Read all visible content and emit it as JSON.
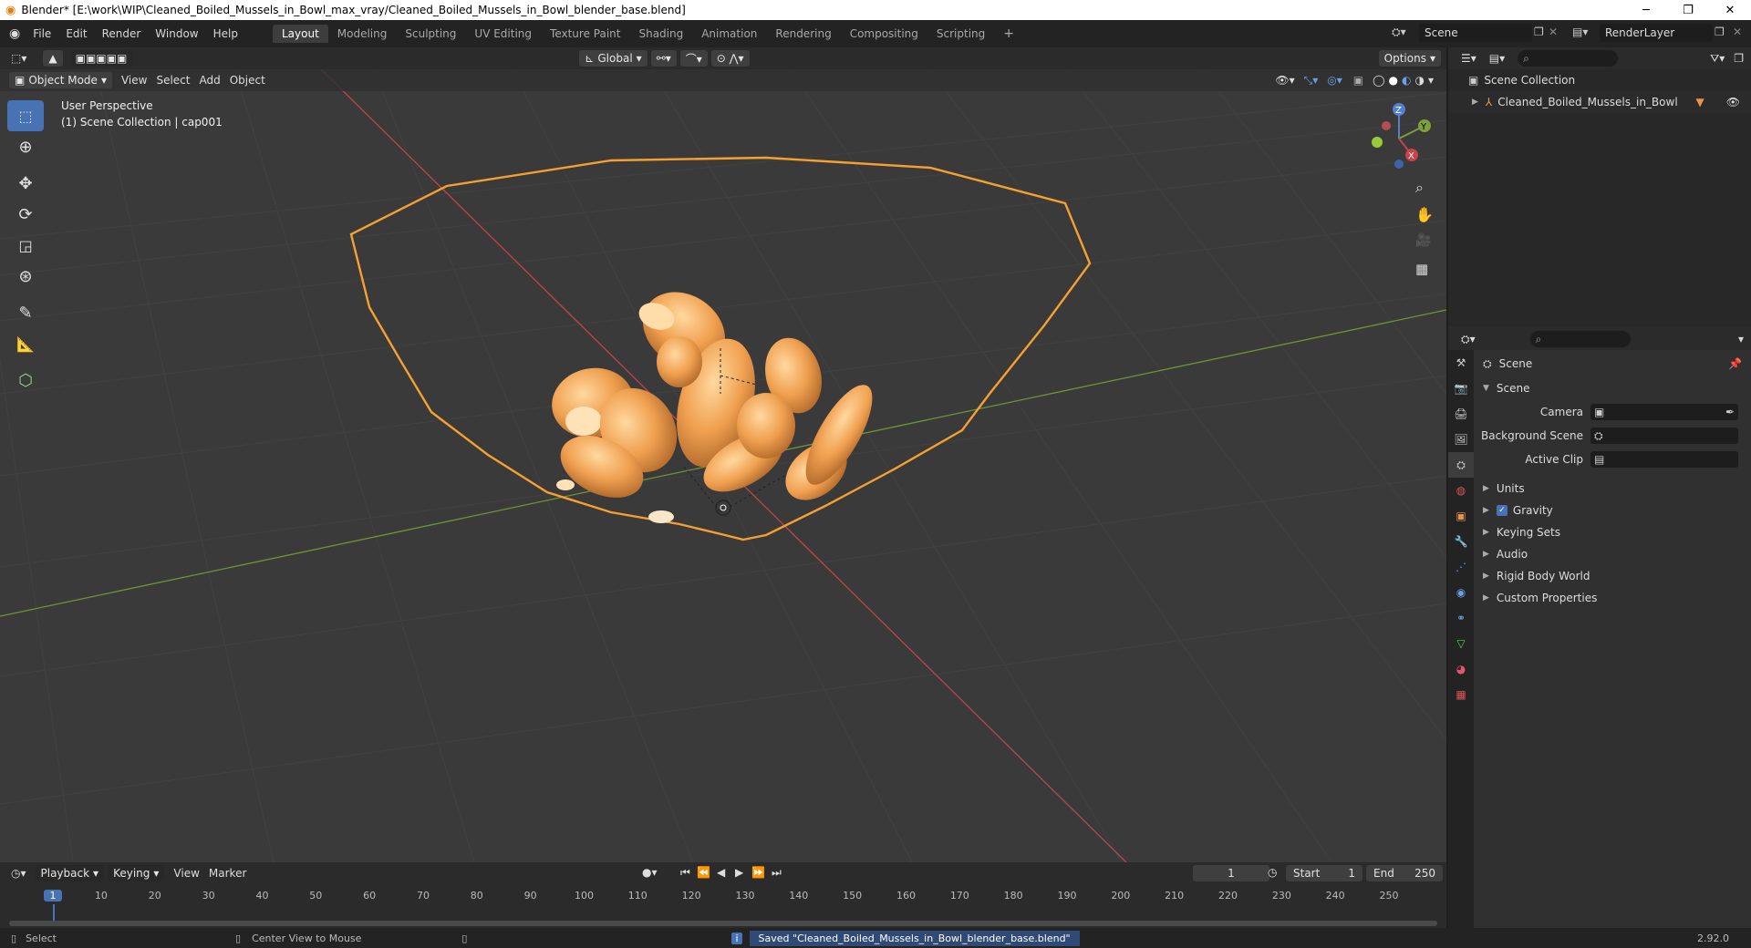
{
  "window": {
    "title": "Blender* [E:\\work\\WIP\\Cleaned_Boiled_Mussels_in_Bowl_max_vray/Cleaned_Boiled_Mussels_in_Bowl_blender_base.blend]",
    "minimize": "─",
    "restore": "❐",
    "close": "✕"
  },
  "menubar": {
    "items": [
      "File",
      "Edit",
      "Render",
      "Window",
      "Help"
    ],
    "workspaces": [
      "Layout",
      "Modeling",
      "Sculpting",
      "UV Editing",
      "Texture Paint",
      "Shading",
      "Animation",
      "Rendering",
      "Compositing",
      "Scripting"
    ],
    "active_workspace": "Layout",
    "add_workspace": "+",
    "scene_name": "Scene",
    "view_layer": "RenderLayer"
  },
  "viewport": {
    "mode": "Object Mode",
    "menus": [
      "View",
      "Select",
      "Add",
      "Object"
    ],
    "transform_orientation": "Global",
    "options_label": "Options",
    "perspective_label": "User Perspective",
    "collection_label": "(1) Scene Collection | cap001",
    "axis_labels": {
      "z": "Z",
      "y": "Y",
      "x": "X"
    }
  },
  "timeline": {
    "menus": [
      "Playback",
      "Keying",
      "View",
      "Marker"
    ],
    "current_frame": "1",
    "start_label": "Start",
    "start_value": "1",
    "end_label": "End",
    "end_value": "250",
    "ruler_ticks": [
      "1",
      "10",
      "20",
      "30",
      "40",
      "50",
      "60",
      "70",
      "80",
      "90",
      "100",
      "110",
      "120",
      "130",
      "140",
      "150",
      "160",
      "170",
      "180",
      "190",
      "200",
      "210",
      "220",
      "230",
      "240",
      "250"
    ]
  },
  "statusbar": {
    "select": "Select",
    "center_view": "Center View to Mouse",
    "message": "Saved \"Cleaned_Boiled_Mussels_in_Bowl_blender_base.blend\"",
    "version": "2.92.0"
  },
  "outliner": {
    "root": "Scene Collection",
    "items": [
      {
        "label": "Cleaned_Boiled_Mussels_in_Bowl"
      }
    ]
  },
  "properties": {
    "context_title": "Scene",
    "section_title": "Scene",
    "fields": [
      {
        "label": "Camera"
      },
      {
        "label": "Background Scene"
      },
      {
        "label": "Active Clip"
      }
    ],
    "panels": [
      {
        "label": "Units",
        "checkbox": false
      },
      {
        "label": "Gravity",
        "checkbox": true
      },
      {
        "label": "Keying Sets",
        "checkbox": false
      },
      {
        "label": "Audio",
        "checkbox": false
      },
      {
        "label": "Rigid Body World",
        "checkbox": false
      },
      {
        "label": "Custom Properties",
        "checkbox": false
      }
    ]
  },
  "colors": {
    "accent": "#4772b3",
    "selection_outline": "#f5a030",
    "object_color": "#f0a050",
    "x_axis": "#c8424a",
    "y_axis": "#7ca03a",
    "grid_bg": "#3a3a3a"
  }
}
